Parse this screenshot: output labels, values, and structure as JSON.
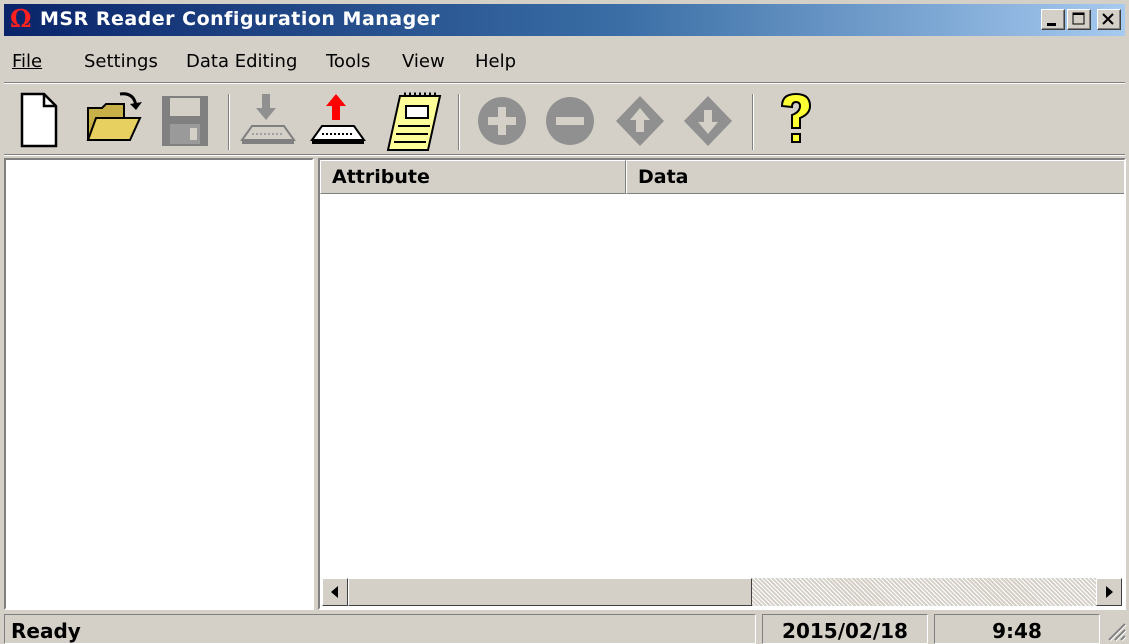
{
  "window": {
    "title": "MSR Reader Configuration Manager",
    "app_icon_glyph": "Ω",
    "icon_color": "#ff2020",
    "titlebar_color": "#0a246a"
  },
  "menu": [
    {
      "label": "File"
    },
    {
      "label": "Settings"
    },
    {
      "label": "Data Editing"
    },
    {
      "label": "Tools"
    },
    {
      "label": "View"
    },
    {
      "label": "Help"
    }
  ],
  "toolbar": {
    "buttons": [
      {
        "name": "new-document",
        "icon": "new-document-icon",
        "enabled": true
      },
      {
        "name": "open-folder",
        "icon": "open-folder-icon",
        "enabled": true
      },
      {
        "name": "save",
        "icon": "floppy-disk-icon",
        "enabled": false
      },
      {
        "name": "download-from-reader",
        "icon": "download-keyboard-icon",
        "enabled": false
      },
      {
        "name": "upload-to-reader",
        "icon": "upload-keyboard-icon",
        "enabled": true
      },
      {
        "name": "notepad",
        "icon": "notepad-icon",
        "enabled": true
      },
      {
        "name": "add",
        "icon": "plus-circle-icon",
        "enabled": false
      },
      {
        "name": "remove",
        "icon": "minus-circle-icon",
        "enabled": false
      },
      {
        "name": "move-up",
        "icon": "arrow-up-diamond-icon",
        "enabled": false
      },
      {
        "name": "move-down",
        "icon": "arrow-down-diamond-icon",
        "enabled": false
      },
      {
        "name": "help",
        "icon": "question-mark-icon",
        "enabled": true
      }
    ]
  },
  "list": {
    "columns": [
      {
        "label": "Attribute"
      },
      {
        "label": "Data"
      }
    ],
    "rows": []
  },
  "status": {
    "message": "Ready",
    "date": "2015/02/18",
    "time": "9:48"
  }
}
